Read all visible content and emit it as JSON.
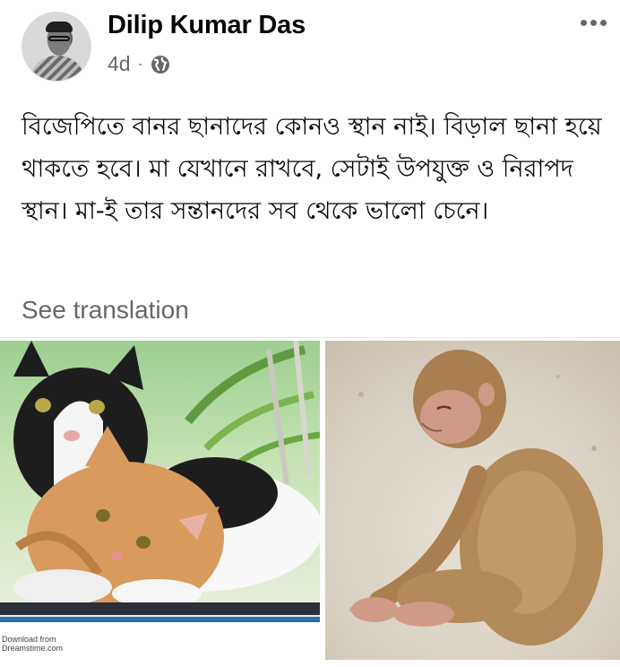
{
  "post": {
    "author": "Dilip Kumar Das",
    "time": "4d",
    "separator": "·",
    "privacy_icon": "globe-icon",
    "menu_icon": "more-horizontal-icon",
    "body": "বিজেপিতে বানর ছানাদের কোনও স্থান নাই। বিড়াল ছানা হয়ে থাকতে হবে। মা যেখানে রাখবে, সেটাই উপযুক্ত  ও নিরাপদ  স্থান। মা-ই তার সন্তানদের  সব থেকে ভালো চেনে।",
    "see_translation": "See translation"
  },
  "photos": {
    "left": {
      "subject": "two-cats-photo",
      "watermark": "Download from\nDreamstime.com"
    },
    "right": {
      "subject": "baby-monkey-photo"
    }
  },
  "colors": {
    "text_primary": "#050505",
    "text_secondary": "#65676b",
    "divider": "#e4e6eb"
  }
}
